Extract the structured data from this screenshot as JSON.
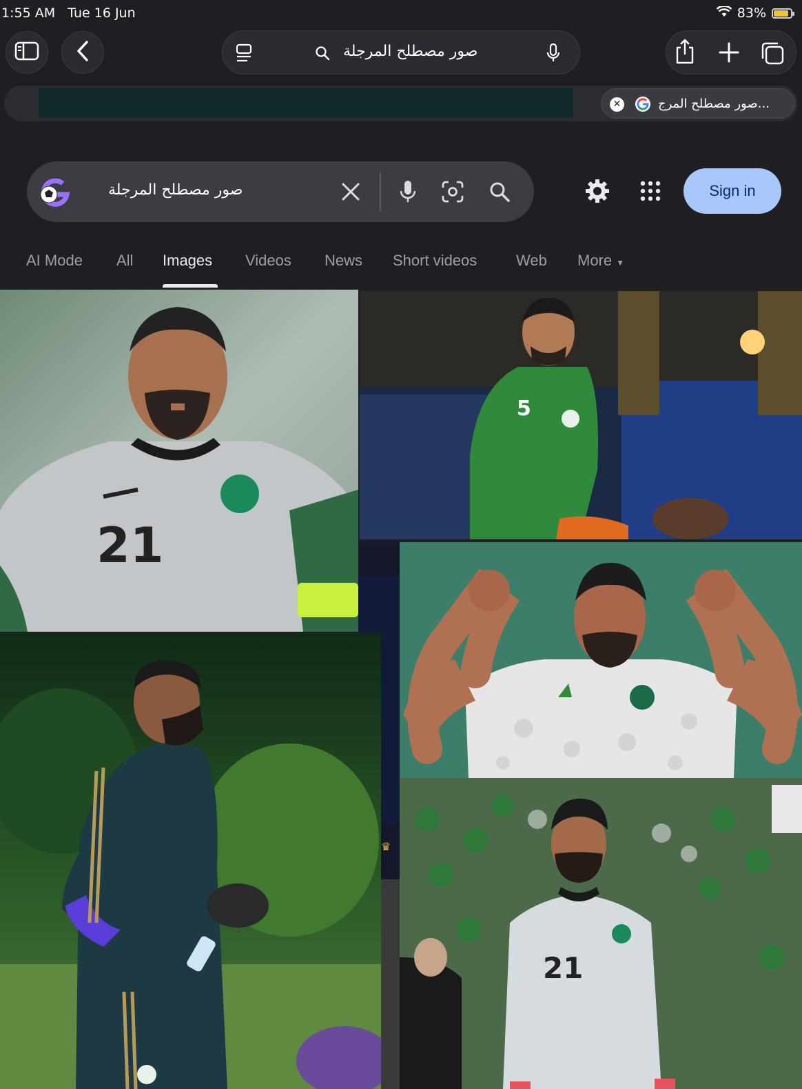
{
  "status_bar": {
    "time": "1:55 AM",
    "date": "Tue 16 Jun",
    "battery": "83%",
    "battery_level": 0.83
  },
  "browser": {
    "address_text": "صور مصطلح المرجلة",
    "tab_title": "صور مصطلح المرج...",
    "icons": [
      "sidebar-icon",
      "back-icon",
      "reader-icon",
      "search-icon",
      "mic-icon",
      "share-icon",
      "plus-icon",
      "tabs-icon"
    ]
  },
  "google": {
    "query": "صور مصطلح المرجلة",
    "sign_in": "Sign in",
    "tabs": [
      {
        "label": "AI Mode",
        "active": false
      },
      {
        "label": "All",
        "active": false
      },
      {
        "label": "Images",
        "active": true
      },
      {
        "label": "Videos",
        "active": false
      },
      {
        "label": "News",
        "active": false
      },
      {
        "label": "Short videos",
        "active": false
      },
      {
        "label": "Web",
        "active": false
      },
      {
        "label": "More",
        "active": false
      }
    ]
  },
  "images": [
    {
      "subject": "player in grey goalkeeper kit",
      "number": "21"
    },
    {
      "subject": "player in green training kit",
      "number": "5"
    },
    {
      "subject": "player flexing in white kit"
    },
    {
      "subject": "player in navy tracksuit"
    },
    {
      "subject": "goalkeeper in stadium",
      "number": "21"
    }
  ],
  "colors": {
    "bg": "#1f1f23",
    "signin_bg": "#a8c7fa",
    "signin_text": "#062e6f",
    "battery": "#f4c430"
  }
}
